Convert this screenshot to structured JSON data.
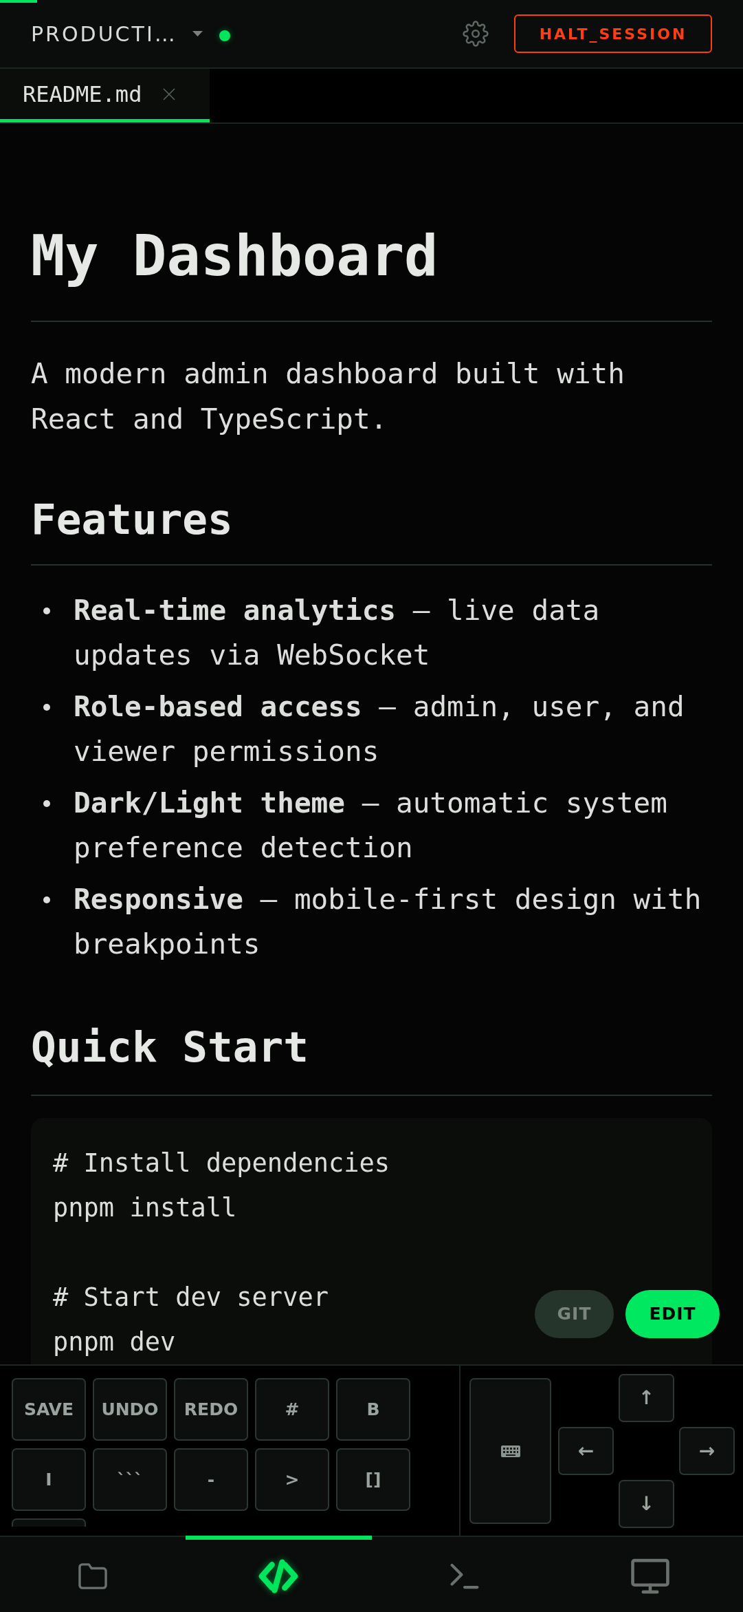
{
  "top_bar": {
    "loading": {
      "level": 0.05
    },
    "session": "PRODUCTI…",
    "connected": true,
    "halt_button": "HALT_SESSION"
  },
  "tabs": [
    {
      "label": "README.md",
      "selected": true
    }
  ],
  "document": {
    "title": "My Dashboard",
    "intro": "A modern admin dashboard built with React and TypeScript.",
    "sections": [
      {
        "heading": "Features",
        "items": [
          "**Real-time analytics** — live data updates via WebSocket",
          "**Role-based access** — admin, user, and viewer permissions",
          "**Dark/Light theme** — automatic system preference detection",
          "**Responsive** — mobile-first design with breakpoints"
        ]
      },
      {
        "heading": "Quick Start",
        "code_groups": [
          {
            "lines": [
              "# Install dependencies",
              "pnpm install"
            ]
          },
          {
            "lines": [
              "# Start dev server",
              "pnpm dev"
            ]
          }
        ]
      }
    ]
  },
  "floating_buttons": [
    {
      "label": "GIT",
      "selected": false
    },
    {
      "label": "EDIT",
      "selected": true
    }
  ],
  "toolbar": {
    "keys": [
      "SAVE",
      "UNDO",
      "REDO",
      "#",
      "B",
      "I",
      "```",
      "-",
      ">",
      "[]"
    ],
    "more_keys_below": true,
    "arrow_keys": [
      {
        "kind": "up",
        "label": "↑"
      },
      {
        "kind": "left",
        "label": "←"
      },
      {
        "kind": "right",
        "label": "→"
      },
      {
        "kind": "down",
        "label": "↓"
      }
    ]
  },
  "bottom_nav": [
    {
      "kind": "files",
      "selected": false
    },
    {
      "kind": "editor",
      "selected": true
    },
    {
      "kind": "terminal",
      "selected": false
    },
    {
      "kind": "display",
      "selected": false
    }
  ]
}
